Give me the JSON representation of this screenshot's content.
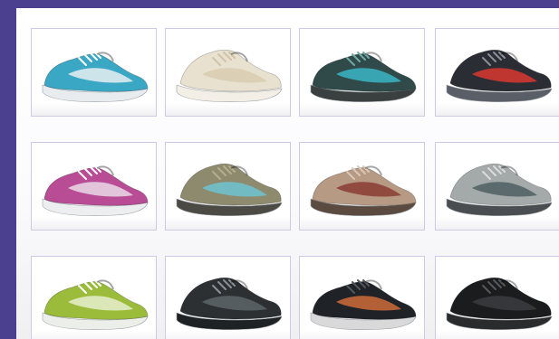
{
  "catalog": {
    "items": [
      {
        "icon": "shoe-icon",
        "upper": "#3aa7c4",
        "accent": "#e9eef2",
        "sole": "#e8ecef",
        "trim": "#ffffff"
      },
      {
        "icon": "shoe-icon",
        "upper": "#e9e1cf",
        "accent": "#d8ccb2",
        "sole": "#f3efe6",
        "trim": "#cfc3a8"
      },
      {
        "icon": "shoe-icon",
        "upper": "#2f4a48",
        "accent": "#3bb5c7",
        "sole": "#3a3f3f",
        "trim": "#6fa9a4"
      },
      {
        "icon": "shoe-icon",
        "upper": "#2b2d35",
        "accent": "#d8382e",
        "sole": "#5a5e66",
        "trim": "#8a8f98"
      },
      {
        "icon": "shoe-icon",
        "upper": "#b84c95",
        "accent": "#e9dbe6",
        "sole": "#eceef0",
        "trim": "#ffffff"
      },
      {
        "icon": "shoe-icon",
        "upper": "#8e8a6e",
        "accent": "#6fc3d2",
        "sole": "#4b4a44",
        "trim": "#b6ad8f"
      },
      {
        "icon": "shoe-icon",
        "upper": "#b79a84",
        "accent": "#8a3d31",
        "sole": "#5a4a40",
        "trim": "#d8c7b6"
      },
      {
        "icon": "shoe-icon",
        "upper": "#a3aaa9",
        "accent": "#4e5f63",
        "sole": "#4a4e50",
        "trim": "#d8dcda"
      },
      {
        "icon": "shoe-icon",
        "upper": "#9bbc3a",
        "accent": "#e6efcd",
        "sole": "#eceee9",
        "trim": "#ffffff"
      },
      {
        "icon": "shoe-icon",
        "upper": "#2d3033",
        "accent": "#5e656a",
        "sole": "#1f2224",
        "trim": "#8a9095"
      },
      {
        "icon": "shoe-icon",
        "upper": "#1f2226",
        "accent": "#cf6b3a",
        "sole": "#d9d9d9",
        "trim": "#52575c"
      },
      {
        "icon": "shoe-icon",
        "upper": "#1b1c1e",
        "accent": "#3a3c40",
        "sole": "#2a2b2d",
        "trim": "#55585c"
      }
    ]
  }
}
